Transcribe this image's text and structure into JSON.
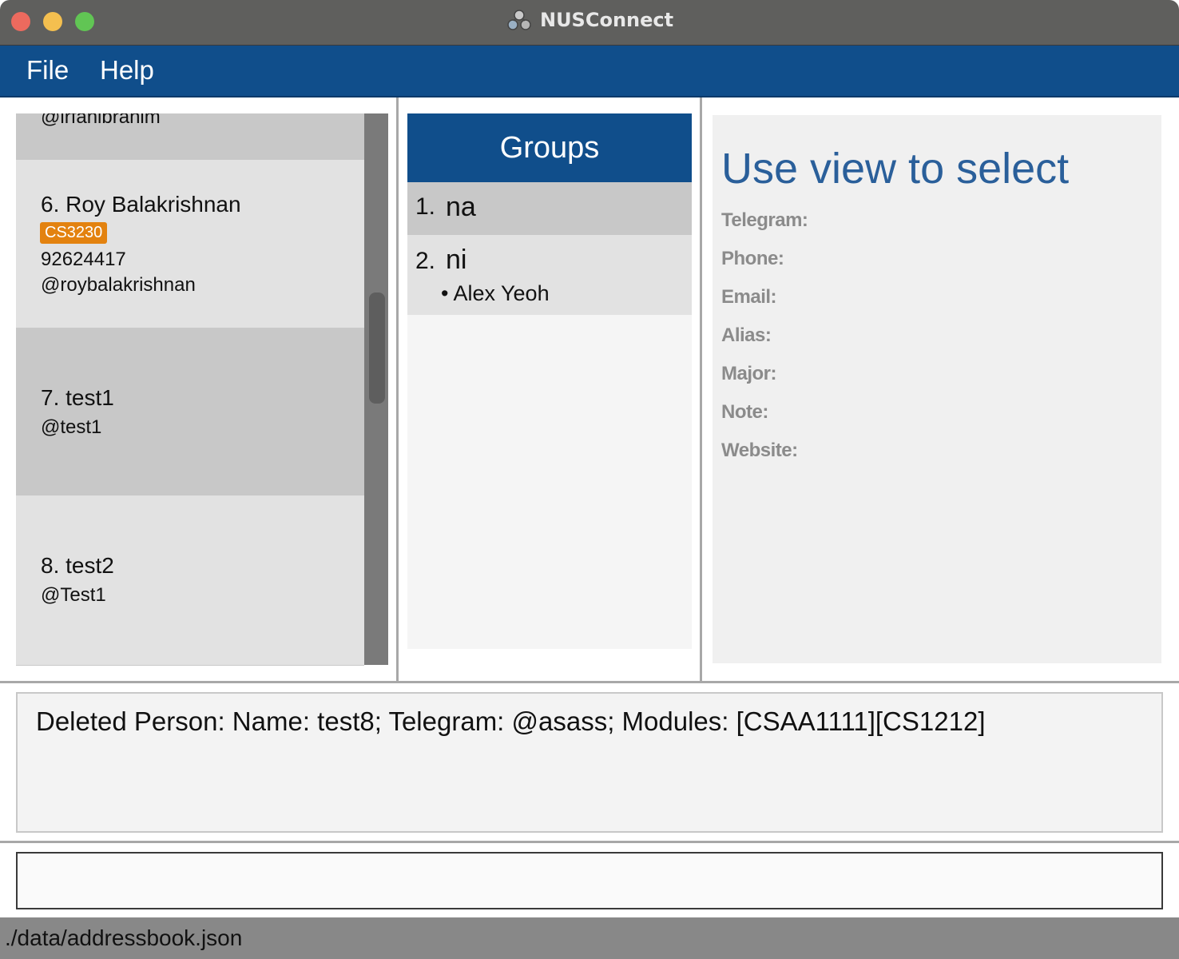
{
  "window": {
    "title": "NUSConnect"
  },
  "menu": {
    "file": "File",
    "help": "Help"
  },
  "person_list": {
    "partial_handle": "@irfanibrahim",
    "cards": [
      {
        "name": "6. Roy Balakrishnan",
        "tag": "CS3230",
        "phone": "92624417",
        "telegram": "@roybalakrishnan"
      },
      {
        "name": "7. test1",
        "telegram": "@test1"
      },
      {
        "name": "8. test2",
        "telegram": "@Test1"
      }
    ]
  },
  "groups": {
    "header": "Groups",
    "items": [
      {
        "index": "1.",
        "name": "na"
      },
      {
        "index": "2.",
        "name": "ni",
        "member": "• Alex Yeoh"
      }
    ]
  },
  "details": {
    "heading": "Use view to select",
    "labels": {
      "telegram": "Telegram:",
      "phone": "Phone:",
      "email": "Email:",
      "alias": "Alias:",
      "major": "Major:",
      "note": "Note:",
      "website": "Website:"
    }
  },
  "result": {
    "text": "Deleted Person: Name: test8; Telegram: @asass; Modules: [CSAA1111][CS1212]"
  },
  "command": {
    "value": ""
  },
  "status": {
    "path": "./data/addressbook.json"
  },
  "colors": {
    "menubar": "#104e8b",
    "groups_header": "#104e8b",
    "tag": "#e3820f",
    "details_heading": "#2a5f9a"
  }
}
